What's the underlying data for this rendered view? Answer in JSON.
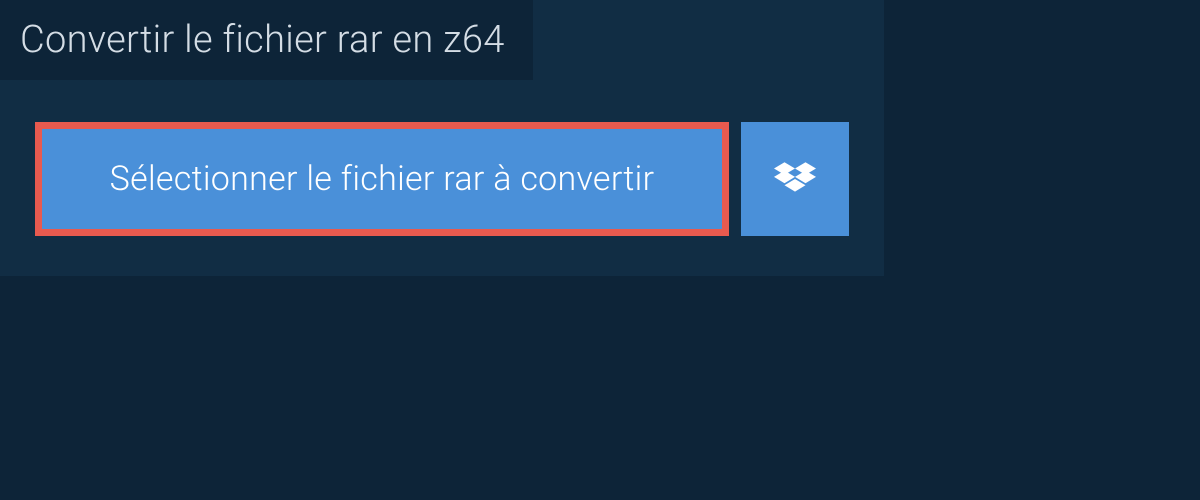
{
  "header": {
    "title": "Convertir le fichier rar en z64"
  },
  "upload": {
    "select_label": "Sélectionner le fichier rar à convertir",
    "dropbox_icon": "dropbox"
  },
  "colors": {
    "background": "#0d2438",
    "panel": "#112d44",
    "button": "#4a90d9",
    "highlight": "#e85a4f",
    "text_light": "#d4dde5",
    "text_white": "#ffffff"
  }
}
